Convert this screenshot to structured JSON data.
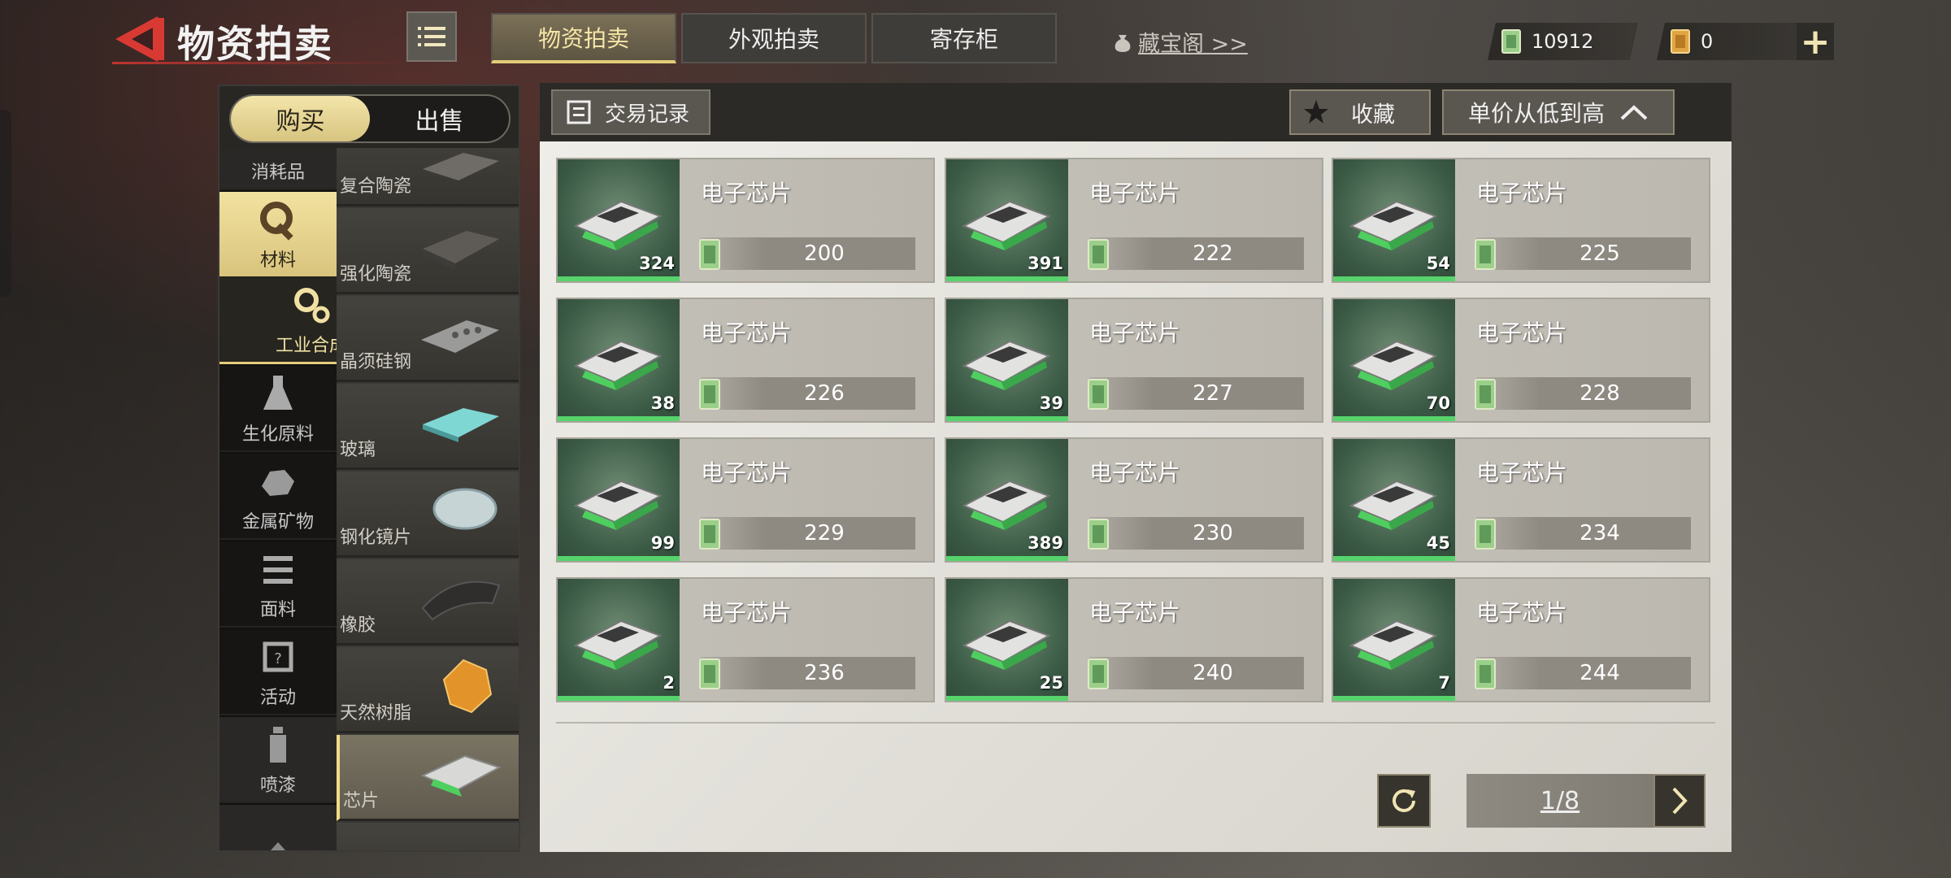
{
  "header": {
    "title": "物资拍卖",
    "tabs": [
      {
        "label": "物资拍卖",
        "active": true
      },
      {
        "label": "外观拍卖",
        "active": false
      },
      {
        "label": "寄存柜",
        "active": false
      }
    ],
    "treasure_link": "藏宝阁 >>",
    "currencies": [
      {
        "icon": "cash-icon",
        "value": "10912"
      },
      {
        "icon": "ticket-icon",
        "value": "0"
      }
    ],
    "plus_label": "+"
  },
  "sidebar": {
    "toggle": {
      "buy": "购买",
      "sell": "出售",
      "selected": "buy"
    },
    "categories": [
      {
        "label": "消耗品",
        "icon": "box-icon"
      },
      {
        "label": "材料",
        "icon": "wrench-gear-icon",
        "selected": true
      },
      {
        "label": "工业合成",
        "icon": "gears-icon",
        "subselected": true
      },
      {
        "label": "生化原料",
        "icon": "flask-icon"
      },
      {
        "label": "金属矿物",
        "icon": "ore-icon"
      },
      {
        "label": "面料",
        "icon": "fabric-icon"
      },
      {
        "label": "活动",
        "icon": "event-chip-icon"
      },
      {
        "label": "喷漆",
        "icon": "spray-can-icon"
      }
    ],
    "subcategories": [
      {
        "label": "复合陶瓷",
        "icon": "ceramic-plate-icon"
      },
      {
        "label": "强化陶瓷",
        "icon": "ceramic-block-icon"
      },
      {
        "label": "晶须硅钢",
        "icon": "steel-plate-icon"
      },
      {
        "label": "玻璃",
        "icon": "glass-icon"
      },
      {
        "label": "钢化镜片",
        "icon": "lens-icon"
      },
      {
        "label": "橡胶",
        "icon": "rubber-icon"
      },
      {
        "label": "天然树脂",
        "icon": "resin-icon"
      },
      {
        "label": "芯片",
        "icon": "chip-icon",
        "selected": true
      }
    ]
  },
  "main": {
    "record_label": "交易记录",
    "favorite_label": "收藏",
    "sort_label": "单价从低到高",
    "items": [
      {
        "name": "电子芯片",
        "qty": "324",
        "price": "200"
      },
      {
        "name": "电子芯片",
        "qty": "391",
        "price": "222"
      },
      {
        "name": "电子芯片",
        "qty": "54",
        "price": "225"
      },
      {
        "name": "电子芯片",
        "qty": "38",
        "price": "226"
      },
      {
        "name": "电子芯片",
        "qty": "39",
        "price": "227"
      },
      {
        "name": "电子芯片",
        "qty": "70",
        "price": "228"
      },
      {
        "name": "电子芯片",
        "qty": "99",
        "price": "229"
      },
      {
        "name": "电子芯片",
        "qty": "389",
        "price": "230"
      },
      {
        "name": "电子芯片",
        "qty": "45",
        "price": "234"
      },
      {
        "name": "电子芯片",
        "qty": "2",
        "price": "236"
      },
      {
        "name": "电子芯片",
        "qty": "25",
        "price": "240"
      },
      {
        "name": "电子芯片",
        "qty": "7",
        "price": "244"
      }
    ],
    "pager": {
      "current": 1,
      "total": 8,
      "text": "1/8"
    }
  },
  "colors": {
    "accent_gold": "#e2cd7a",
    "rarity_green": "#56d36b",
    "back_red": "#d83a33"
  }
}
